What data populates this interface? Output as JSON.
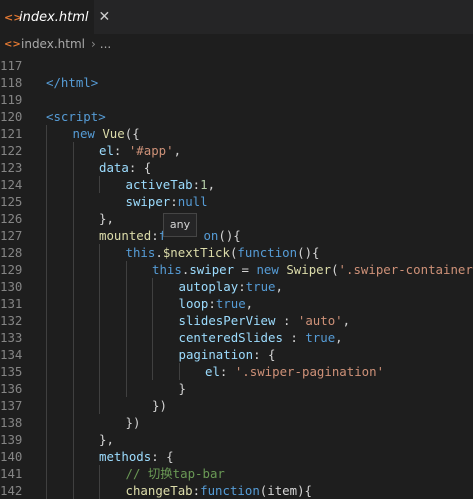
{
  "tab": {
    "icon": "<>",
    "label": "index.html",
    "close": "✕"
  },
  "breadcrumb": {
    "icon": "<>",
    "file": "index.html",
    "separator": "›",
    "more": "..."
  },
  "tooltip": {
    "text": "any"
  },
  "lines": [
    {
      "n": "117",
      "indent": 0,
      "tokens": []
    },
    {
      "n": "118",
      "indent": 0,
      "tokens": [
        [
          "tag",
          "</html>"
        ]
      ]
    },
    {
      "n": "119",
      "indent": 0,
      "tokens": []
    },
    {
      "n": "120",
      "indent": 0,
      "tokens": [
        [
          "tag",
          "<script>"
        ]
      ]
    },
    {
      "n": "121",
      "indent": 1,
      "tokens": [
        [
          "kw",
          "new "
        ],
        [
          "fn",
          "Vue"
        ],
        [
          "pun",
          "({"
        ]
      ]
    },
    {
      "n": "122",
      "indent": 2,
      "tokens": [
        [
          "prop",
          "el"
        ],
        [
          "pun",
          ": "
        ],
        [
          "str",
          "'#app'"
        ],
        [
          "pun",
          ","
        ]
      ]
    },
    {
      "n": "123",
      "indent": 2,
      "tokens": [
        [
          "prop",
          "data"
        ],
        [
          "pun",
          ": {"
        ]
      ]
    },
    {
      "n": "124",
      "indent": 3,
      "tokens": [
        [
          "prop",
          "activeTab"
        ],
        [
          "pun",
          ":"
        ],
        [
          "num",
          "1"
        ],
        [
          "pun",
          ","
        ]
      ]
    },
    {
      "n": "125",
      "indent": 3,
      "tokens": [
        [
          "prop",
          "swiper"
        ],
        [
          "pun",
          ":"
        ],
        [
          "kw",
          "null"
        ]
      ]
    },
    {
      "n": "126",
      "indent": 2,
      "tokens": [
        [
          "pun",
          "},"
        ]
      ]
    },
    {
      "n": "127",
      "indent": 2,
      "tokens": [
        [
          "fn",
          "mounted"
        ],
        [
          "pun",
          ":"
        ],
        [
          "kw",
          "f"
        ],
        [
          "pun",
          "     "
        ],
        [
          "kw",
          "on"
        ],
        [
          "pun",
          "(){"
        ]
      ]
    },
    {
      "n": "128",
      "indent": 3,
      "tokens": [
        [
          "kw",
          "this"
        ],
        [
          "pun",
          "."
        ],
        [
          "fn",
          "$nextTick"
        ],
        [
          "pun",
          "("
        ],
        [
          "kw",
          "function"
        ],
        [
          "pun",
          "(){"
        ]
      ]
    },
    {
      "n": "129",
      "indent": 4,
      "tokens": [
        [
          "kw",
          "this"
        ],
        [
          "pun",
          "."
        ],
        [
          "prop",
          "swiper"
        ],
        [
          "pun",
          " = "
        ],
        [
          "kw",
          "new "
        ],
        [
          "fn",
          "Swiper"
        ],
        [
          "pun",
          "("
        ],
        [
          "str",
          "'.swiper-container'"
        ],
        [
          "pun",
          ",{"
        ]
      ]
    },
    {
      "n": "130",
      "indent": 5,
      "tokens": [
        [
          "prop",
          "autoplay"
        ],
        [
          "pun",
          ":"
        ],
        [
          "kw",
          "true"
        ],
        [
          "pun",
          ","
        ]
      ]
    },
    {
      "n": "131",
      "indent": 5,
      "tokens": [
        [
          "prop",
          "loop"
        ],
        [
          "pun",
          ":"
        ],
        [
          "kw",
          "true"
        ],
        [
          "pun",
          ","
        ]
      ]
    },
    {
      "n": "132",
      "indent": 5,
      "tokens": [
        [
          "prop",
          "slidesPerView"
        ],
        [
          "pun",
          " : "
        ],
        [
          "str",
          "'auto'"
        ],
        [
          "pun",
          ","
        ]
      ]
    },
    {
      "n": "133",
      "indent": 5,
      "tokens": [
        [
          "prop",
          "centeredSlides"
        ],
        [
          "pun",
          " : "
        ],
        [
          "kw",
          "true"
        ],
        [
          "pun",
          ","
        ]
      ]
    },
    {
      "n": "134",
      "indent": 5,
      "tokens": [
        [
          "prop",
          "pagination"
        ],
        [
          "pun",
          ": {"
        ]
      ]
    },
    {
      "n": "135",
      "indent": 6,
      "tokens": [
        [
          "prop",
          "el"
        ],
        [
          "pun",
          ": "
        ],
        [
          "str",
          "'.swiper-pagination'"
        ]
      ]
    },
    {
      "n": "136",
      "indent": 5,
      "tokens": [
        [
          "pun",
          "}"
        ]
      ]
    },
    {
      "n": "137",
      "indent": 4,
      "tokens": [
        [
          "pun",
          "})"
        ]
      ]
    },
    {
      "n": "138",
      "indent": 3,
      "tokens": [
        [
          "pun",
          "})"
        ]
      ]
    },
    {
      "n": "139",
      "indent": 2,
      "tokens": [
        [
          "pun",
          "},"
        ]
      ]
    },
    {
      "n": "140",
      "indent": 2,
      "tokens": [
        [
          "prop",
          "methods"
        ],
        [
          "pun",
          ": {"
        ]
      ]
    },
    {
      "n": "141",
      "indent": 3,
      "tokens": [
        [
          "cmt",
          "// 切换tap-bar"
        ]
      ]
    },
    {
      "n": "142",
      "indent": 3,
      "tokens": [
        [
          "fn",
          "changeTab"
        ],
        [
          "pun",
          ":"
        ],
        [
          "kw",
          "function"
        ],
        [
          "pun",
          "(item){"
        ]
      ]
    }
  ]
}
